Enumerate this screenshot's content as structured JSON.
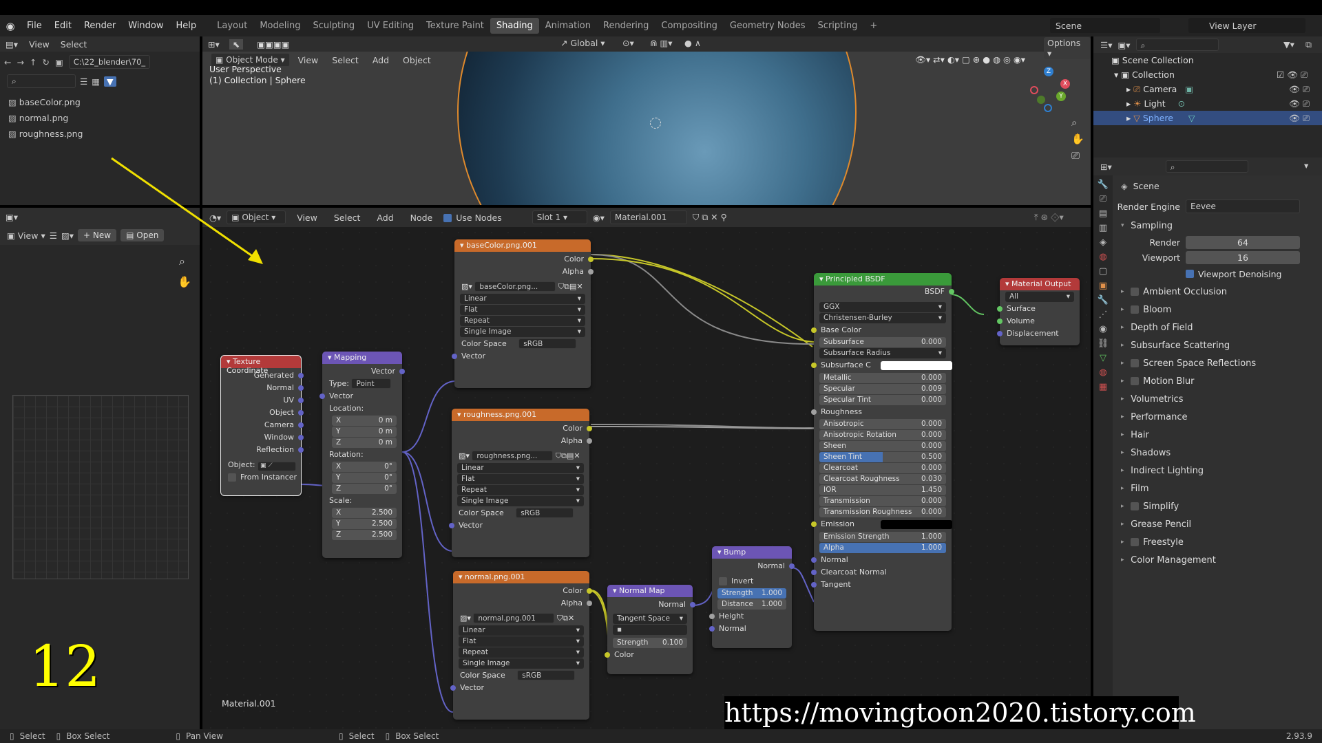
{
  "menu": {
    "file": "File",
    "edit": "Edit",
    "render": "Render",
    "window": "Window",
    "help": "Help"
  },
  "workspaces": [
    "Layout",
    "Modeling",
    "Sculpting",
    "UV Editing",
    "Texture Paint",
    "Shading",
    "Animation",
    "Rendering",
    "Compositing",
    "Geometry Nodes",
    "Scripting"
  ],
  "scene_name": "Scene",
  "view_layer": "View Layer",
  "filebrowser": {
    "view": "View",
    "select": "Select",
    "path": "C:\\22_blender\\70_",
    "files": [
      "baseColor.png",
      "normal.png",
      "roughness.png"
    ]
  },
  "viewport": {
    "mode": "Object Mode",
    "view": "View",
    "select": "Select",
    "add": "Add",
    "object": "Object",
    "orientation": "Global",
    "options": "Options",
    "info1": "User Perspective",
    "info2": "(1) Collection | Sphere"
  },
  "outliner": {
    "root": "Scene Collection",
    "collection": "Collection",
    "items": [
      "Camera",
      "Light",
      "Sphere"
    ]
  },
  "properties": {
    "scene": "Scene",
    "render_engine_label": "Render Engine",
    "render_engine": "Eevee",
    "sampling": "Sampling",
    "render_label": "Render",
    "render_val": "64",
    "viewport_label": "Viewport",
    "viewport_val": "16",
    "denoise": "Viewport Denoising",
    "panels": [
      "Ambient Occlusion",
      "Bloom",
      "Depth of Field",
      "Subsurface Scattering",
      "Screen Space Reflections",
      "Motion Blur",
      "Volumetrics",
      "Performance",
      "Hair",
      "Shadows",
      "Indirect Lighting",
      "Film",
      "Simplify",
      "Grease Pencil",
      "Freestyle",
      "Color Management"
    ]
  },
  "imgeditor": {
    "view": "View",
    "new": "New",
    "open": "Open"
  },
  "node_header": {
    "object": "Object",
    "view": "View",
    "select": "Select",
    "add": "Add",
    "node": "Node",
    "use_nodes": "Use Nodes",
    "slot": "Slot 1",
    "material": "Material.001"
  },
  "texcoord": {
    "title": "Texture Coordinate",
    "outs": [
      "Generated",
      "Normal",
      "UV",
      "Object",
      "Camera",
      "Window",
      "Reflection"
    ],
    "object": "Object:",
    "from_instancer": "From Instancer"
  },
  "mapping": {
    "title": "Mapping",
    "vector": "Vector",
    "type_label": "Type:",
    "type": "Point",
    "vector_in": "Vector",
    "location": "Location:",
    "rotation": "Rotation:",
    "scale": "Scale:",
    "loc": [
      [
        "X",
        "0 m"
      ],
      [
        "Y",
        "0 m"
      ],
      [
        "Z",
        "0 m"
      ]
    ],
    "rot": [
      [
        "X",
        "0°"
      ],
      [
        "Y",
        "0°"
      ],
      [
        "Z",
        "0°"
      ]
    ],
    "scl": [
      [
        "X",
        "2.500"
      ],
      [
        "Y",
        "2.500"
      ],
      [
        "Z",
        "2.500"
      ]
    ]
  },
  "tex1": {
    "title": "baseColor.png.001",
    "img": "baseColor.png...",
    "color": "Color",
    "alpha": "Alpha",
    "interp": "Linear",
    "proj": "Flat",
    "ext": "Repeat",
    "src": "Single Image",
    "cs_label": "Color Space",
    "cs": "sRGB",
    "vector": "Vector"
  },
  "tex2": {
    "title": "roughness.png.001",
    "img": "roughness.png...",
    "color": "Color",
    "alpha": "Alpha",
    "interp": "Linear",
    "proj": "Flat",
    "ext": "Repeat",
    "src": "Single Image",
    "cs_label": "Color Space",
    "cs": "sRGB",
    "vector": "Vector"
  },
  "tex3": {
    "title": "normal.png.001",
    "img": "normal.png.001",
    "color": "Color",
    "alpha": "Alpha",
    "interp": "Linear",
    "proj": "Flat",
    "ext": "Repeat",
    "src": "Single Image",
    "cs_label": "Color Space",
    "cs": "sRGB",
    "vector": "Vector"
  },
  "normalmap": {
    "title": "Normal Map",
    "normal": "Normal",
    "space": "Tangent Space",
    "strength_label": "Strength",
    "strength": "0.100",
    "color": "Color"
  },
  "bump": {
    "title": "Bump",
    "normal": "Normal",
    "invert": "Invert",
    "strength_label": "Strength",
    "strength": "1.000",
    "distance_label": "Distance",
    "distance": "1.000",
    "height": "Height",
    "normal_in": "Normal"
  },
  "bsdf": {
    "title": "Principled BSDF",
    "bsdf": "BSDF",
    "dist": "GGX",
    "sss": "Christensen-Burley",
    "base_color": "Base Color",
    "fields": [
      [
        "Subsurface",
        "0.000"
      ]
    ],
    "ss_radius": "Subsurface Radius",
    "ss_color": "Subsurface C",
    "fields2": [
      [
        "Metallic",
        "0.000"
      ],
      [
        "Specular",
        "0.009"
      ],
      [
        "Specular Tint",
        "0.000"
      ]
    ],
    "roughness": "Roughness",
    "fields3": [
      [
        "Anisotropic",
        "0.000"
      ],
      [
        "Anisotropic Rotation",
        "0.000"
      ],
      [
        "Sheen",
        "0.000"
      ],
      [
        "Sheen Tint",
        "0.500"
      ],
      [
        "Clearcoat",
        "0.000"
      ],
      [
        "Clearcoat Roughness",
        "0.030"
      ],
      [
        "IOR",
        "1.450"
      ],
      [
        "Transmission",
        "0.000"
      ],
      [
        "Transmission Roughness",
        "0.000"
      ]
    ],
    "emission": "Emission",
    "emission_strength_label": "Emission Strength",
    "emission_strength": "1.000",
    "alpha_label": "Alpha",
    "alpha": "1.000",
    "normal": "Normal",
    "clearcoat_normal": "Clearcoat Normal",
    "tangent": "Tangent"
  },
  "matout": {
    "title": "Material Output",
    "target": "All",
    "surface": "Surface",
    "volume": "Volume",
    "displacement": "Displacement"
  },
  "material_label": "Material.001",
  "overlay_number": "12",
  "watermark": "https://movingtoon2020.tistory.com",
  "status": {
    "select": "Select",
    "box_select": "Box Select",
    "pan_view": "Pan View",
    "select2": "Select",
    "box_select2": "Box Select",
    "version": "2.93.9"
  }
}
